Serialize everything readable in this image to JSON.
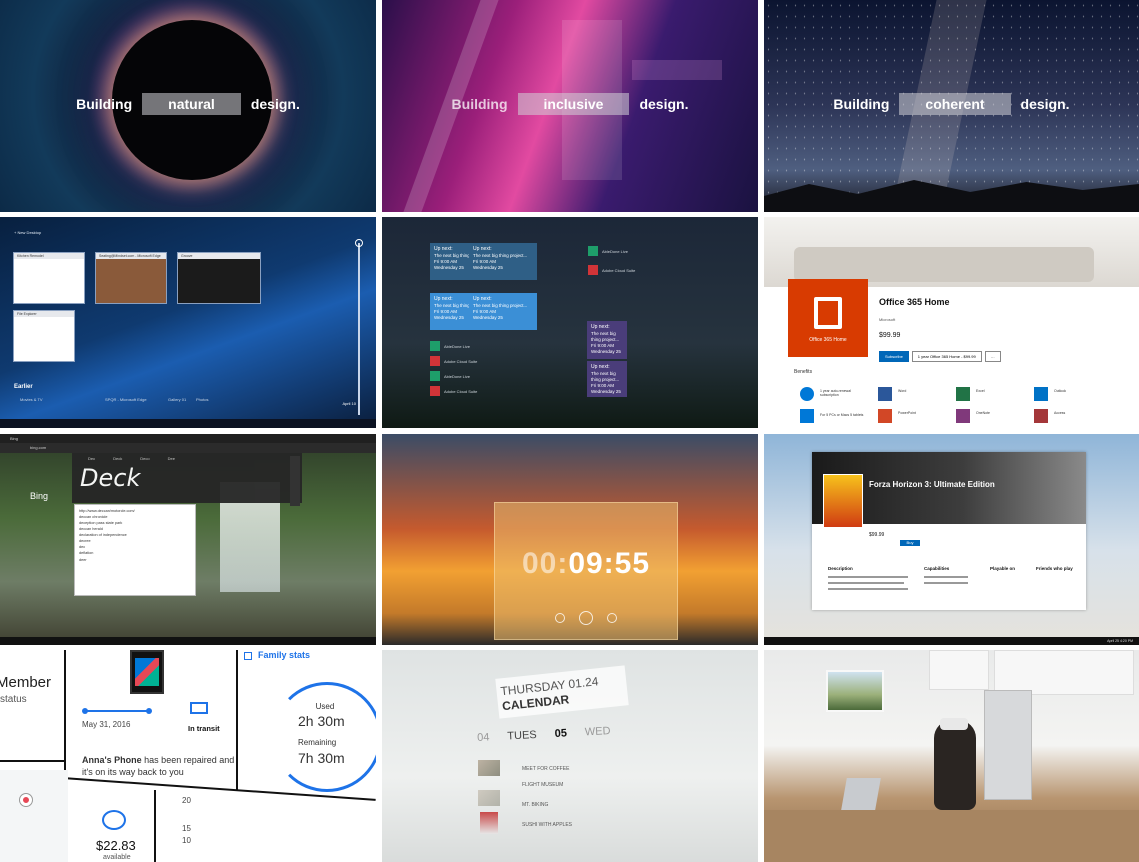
{
  "row1": {
    "natural": {
      "prefix": "Building",
      "word": "natural",
      "suffix": "design."
    },
    "inclusive": {
      "prefix": "Building",
      "word": "inclusive",
      "suffix": "design."
    },
    "coherent": {
      "prefix": "Building",
      "word": "coherent",
      "suffix": "design."
    }
  },
  "taskview": {
    "new_desktop": "+ New Desktop",
    "windows": [
      {
        "title": "Kitchen Remodel"
      },
      {
        "title": "Seating@Mindset.com - Microsoft Edge"
      },
      {
        "title": "Groove"
      },
      {
        "title": "File Explorer"
      }
    ],
    "earlier_label": "Earlier",
    "date_label": "April 10",
    "bottom_labels": [
      "Movies & TV",
      "SPQR - Microsoft Edge",
      "Gallery 01",
      "Photos"
    ]
  },
  "notifications": {
    "cards": [
      {
        "head": "Up next:",
        "body": "The next big thing project...",
        "time": "Fri 9:00 AM",
        "day": "Wednesday 25"
      },
      {
        "head": "Up next:",
        "body": "The next big thing project...",
        "time": "Fri 9:00 AM",
        "day": "Wednesday 25"
      },
      {
        "head": "Up next:",
        "body": "The next big thing project...",
        "time": "Fri 9:00 AM",
        "day": "Wednesday 25"
      },
      {
        "head": "Up next:",
        "body": "The next big thing project...",
        "time": "Fri 9:00 AM",
        "day": "Wednesday 25"
      },
      {
        "head": "Up next:",
        "body": "The next big thing project...",
        "time": "Fri 9:00 AM",
        "day": "Wednesday 25"
      },
      {
        "head": "Up next:",
        "body": "The next big thing project...",
        "time": "Fri 9:00 AM",
        "day": "Wednesday 25"
      }
    ],
    "apps": [
      "AbleDone Live",
      "Adobe Cloud Suite",
      "AbleDone Live",
      "Adobe Cloud Suite",
      "AbleDone Live",
      "Adobe Cloud Suite"
    ]
  },
  "office": {
    "tile_label": "Office 365 Home",
    "title": "Office 365 Home",
    "publisher": "Microsoft",
    "price": "$99.99",
    "subscribe": "Subscribe",
    "plan": "1 year Office 365 Home - $99.99",
    "benefits_label": "Benefits",
    "benefits": [
      "1 year auto-renewal subscription",
      "For 5 PCs or Macs 5 tablets",
      "Word",
      "PowerPoint",
      "Excel",
      "OneNote",
      "Outlook",
      "Access"
    ]
  },
  "browser": {
    "tab_title": "Bing",
    "address": "bing.com",
    "ink_tabs": [
      "Dec",
      "Deck",
      "Deco",
      "Dee"
    ],
    "ink_word": "Deck",
    "brand": "Bing",
    "suggestions": [
      "http://www.deccan/motorcle.com/",
      "deccan chronicle",
      "deception pass state park",
      "deccan herald",
      "declaration of independence",
      "decree",
      "dec",
      "deflation",
      "deer"
    ]
  },
  "timer": {
    "time_dim": "00:",
    "time_main": "09:55"
  },
  "forza": {
    "title": "Forza Horizon 3: Ultimate Edition",
    "price": "$99.99",
    "buy": "Buy",
    "sections": [
      "Description",
      "Capabilities",
      "Playable on",
      "Friends who play"
    ],
    "date": "April 25 4:20 PM"
  },
  "family": {
    "member": "Member",
    "status": "status",
    "date": "May 31, 2016",
    "transit": "In transit",
    "anna_name": "Anna's Phone",
    "anna_text": "has been repaired and it's on its way back to you",
    "stats_title": "Family stats",
    "used_label": "Used",
    "used_value": "2h 30m",
    "remaining_label": "Remaining",
    "remaining_value": "7h 30m",
    "money": "$22.83",
    "available": "available",
    "n20": "20",
    "n15": "15",
    "n10": "10"
  },
  "calendar": {
    "day": "THURSDAY 01.24",
    "title": "CALENDAR",
    "cols": [
      "04",
      "TUES",
      "05",
      "WED"
    ],
    "events": [
      "MEET FOR COFFEE",
      "FLIGHT MUSEUM",
      "MT. BIKING",
      "SUSHI WITH APPLES"
    ]
  }
}
